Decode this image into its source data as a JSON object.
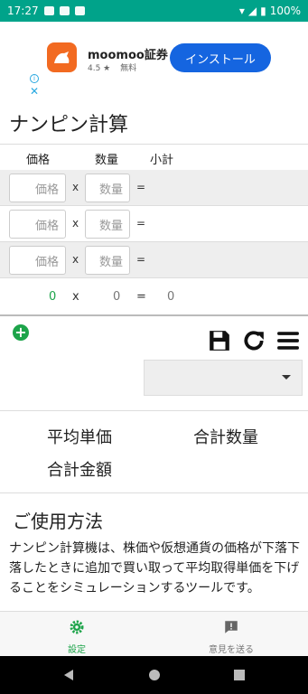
{
  "status": {
    "time": "17:27",
    "battery": "100%"
  },
  "ad": {
    "title": "moomoo証券",
    "rating": "4.5 ★",
    "price": "無料",
    "install": "インストール",
    "info": "i",
    "close": "✕",
    "brand_color": "#f26a21",
    "button_color": "#1565e0"
  },
  "page": {
    "title": "ナンピン計算"
  },
  "table": {
    "headers": {
      "price": "価格",
      "qty": "数量",
      "subtotal": "小計"
    },
    "rows": [
      {
        "price_placeholder": "価格",
        "x": "x",
        "qty_placeholder": "数量",
        "eq": "=",
        "subtotal": ""
      },
      {
        "price_placeholder": "価格",
        "x": "x",
        "qty_placeholder": "数量",
        "eq": "=",
        "subtotal": ""
      },
      {
        "price_placeholder": "価格",
        "x": "x",
        "qty_placeholder": "数量",
        "eq": "=",
        "subtotal": ""
      }
    ],
    "total": {
      "price": "0",
      "x": "x",
      "qty": "0",
      "eq": "=",
      "subtotal": "0"
    }
  },
  "toolbar": {
    "add_icon": "plus-circle",
    "save_icon": "floppy-disk",
    "refresh_icon": "refresh",
    "menu_icon": "hamburger",
    "select_value": ""
  },
  "summary": {
    "avg_price": "平均単価",
    "total_qty": "合計数量",
    "total_amount": "合計金額"
  },
  "usage": {
    "title": "ご使用方法",
    "text": "ナンピン計算機は、株価や仮想通貨の価格が下落下落したときに追加で買い取って平均取得単価を下げることをシミュレーションするツールです。"
  },
  "bottom_nav": [
    {
      "label": "設定",
      "icon": "gear",
      "active": true
    },
    {
      "label": "意見を送る",
      "icon": "feedback"
    }
  ],
  "colors": {
    "status_bar": "#00a38a",
    "accent_green": "#1da44a"
  }
}
